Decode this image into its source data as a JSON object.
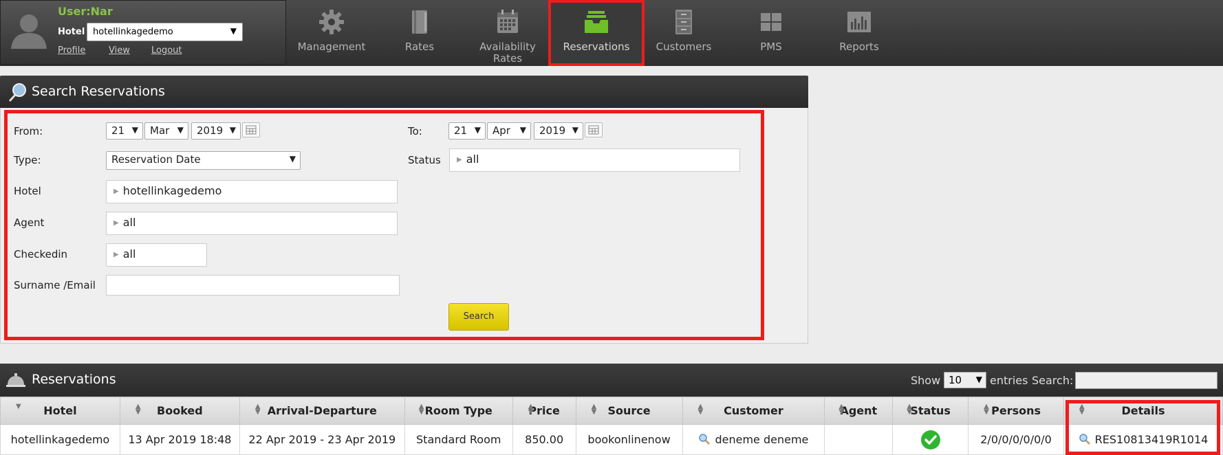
{
  "user": {
    "label": "User:Nar",
    "hotel_label": "Hotel",
    "hotel_value": "hotellinkagedemo",
    "links": [
      "Profile",
      "View",
      "Logout"
    ]
  },
  "nav": [
    {
      "label": "Management",
      "icon": "gear-icon"
    },
    {
      "label": "Rates",
      "icon": "book-icon"
    },
    {
      "label": "Availability Rates",
      "icon": "calendar-icon"
    },
    {
      "label": "Reservations",
      "icon": "inbox-tray-icon",
      "active": true
    },
    {
      "label": "Customers",
      "icon": "file-cabinet-icon"
    },
    {
      "label": "PMS",
      "icon": "grid-icon"
    },
    {
      "label": "Reports",
      "icon": "bar-chart-icon"
    }
  ],
  "search_panel": {
    "title": "Search Reservations",
    "from_label": "From:",
    "from_day": "21",
    "from_month": "Mar",
    "from_year": "2019",
    "to_label": "To:",
    "to_day": "21",
    "to_month": "Apr",
    "to_year": "2019",
    "type_label": "Type:",
    "type_value": "Reservation Date",
    "status_label": "Status",
    "status_value": "all",
    "hotel_label": "Hotel",
    "hotel_value": "hotellinkagedemo",
    "agent_label": "Agent",
    "agent_value": "all",
    "checkedin_label": "Checkedin",
    "checkedin_value": "all",
    "surname_label": "Surname /Email",
    "surname_value": "",
    "search_button": "Search"
  },
  "reservations": {
    "title": "Reservations",
    "show_label": "Show",
    "entries_value": "10",
    "entries_label": "entries",
    "search_label": "Search:",
    "columns": [
      "Hotel",
      "Booked",
      "Arrival-Departure",
      "Room Type",
      "Price",
      "Source",
      "Customer",
      "Agent",
      "Status",
      "Persons",
      "Details"
    ],
    "rows": [
      {
        "hotel": "hotellinkagedemo",
        "booked": "13 Apr 2019 18:48",
        "arrival_departure": "22 Apr 2019 - 23 Apr 2019",
        "room_type": "Standard Room",
        "price": "850.00",
        "source": "bookonlinenow",
        "customer": "deneme deneme",
        "agent": "",
        "status": "confirmed",
        "persons": "2/0/0/0/0/0/0",
        "details": "RES10813419R1014"
      }
    ]
  },
  "colors": {
    "highlight": "#ee1c1c",
    "user_green": "#8bc34a",
    "button_yellow": "#e8d512",
    "status_green": "#2fb52f",
    "active_icon_green": "#6fbf2a"
  }
}
